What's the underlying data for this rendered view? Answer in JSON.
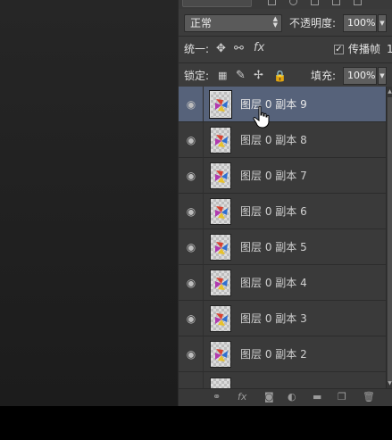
{
  "blend": {
    "mode": "正常",
    "opacity_label": "不透明度:",
    "opacity_value": "100%"
  },
  "unify": {
    "label": "统一:",
    "fx_label": "fx",
    "propagate_checked": true,
    "propagate_label": "传播帧",
    "propagate_suffix": "1"
  },
  "lock": {
    "label": "锁定:",
    "fill_label": "填充:",
    "fill_value": "100%"
  },
  "layers": [
    {
      "name": "图层 0 副本 9",
      "selected": true
    },
    {
      "name": "图层 0 副本 8",
      "selected": false
    },
    {
      "name": "图层 0 副本 7",
      "selected": false
    },
    {
      "name": "图层 0 副本 6",
      "selected": false
    },
    {
      "name": "图层 0 副本 5",
      "selected": false
    },
    {
      "name": "图层 0 副本 4",
      "selected": false
    },
    {
      "name": "图层 0 副本 3",
      "selected": false
    },
    {
      "name": "图层 0 副本 2",
      "selected": false
    }
  ],
  "toolbar": {
    "fx_label": "fx"
  },
  "colors": {
    "selected_row": "#56627a",
    "panel_bg": "#3c3c3c"
  }
}
